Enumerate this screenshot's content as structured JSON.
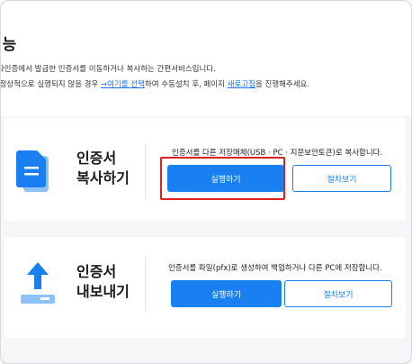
{
  "page": {
    "title": "기능",
    "desc_line1": "지자인증에서 발급한 인증서를 이동하거나 복사하는 간편서비스입니다.",
    "desc_line2_prefix": "이 정상적으로 실행되지 않을 경우 ",
    "desc_line2_link1": "→여기를 선택",
    "desc_line2_mid": "하여 수동설치 후, 페이지 ",
    "desc_line2_link2": "새로고침",
    "desc_line2_suffix": "을 진행해주세요."
  },
  "copy_card": {
    "title_line1": "인증서",
    "title_line2": "복사하기",
    "description": "인증서를 다른 저장매체(USB · PC · 지문보안토큰)로 복사합니다.",
    "run_label": "실행하기",
    "guide_label": "절차보기",
    "icon": "documents-copy-icon"
  },
  "export_card": {
    "title_line1": "인증서",
    "title_line2": "내보내기",
    "description": "인증서를 파일(pfx)로 생성하여 백업하거나 다른 PC에 저장합니다.",
    "run_label": "실행하기",
    "guide_label": "절차보기",
    "icon": "upload-tray-icon"
  },
  "colors": {
    "accent": "#1a7ff0",
    "highlight": "#e02020",
    "background": "#f5f6f8"
  }
}
